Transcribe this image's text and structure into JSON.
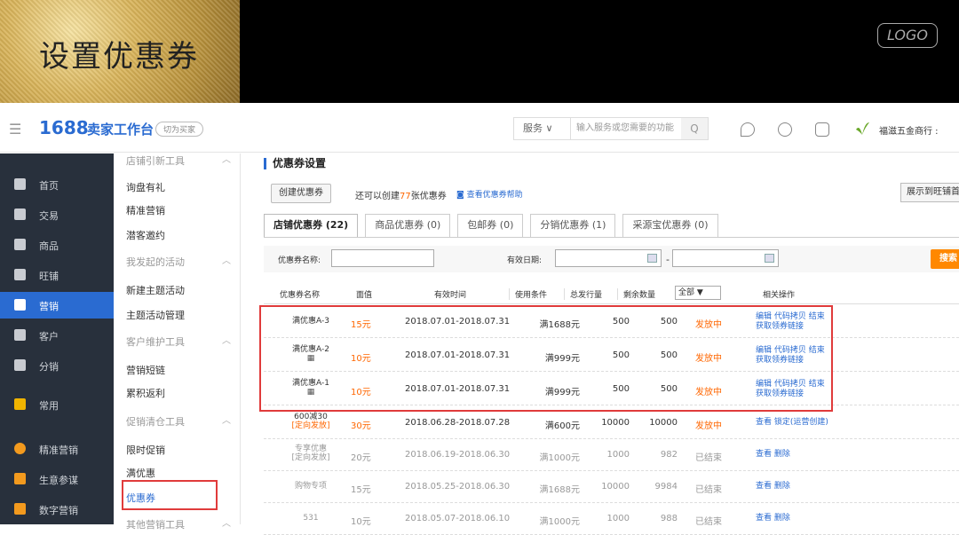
{
  "banner": {
    "title": "设置优惠券",
    "logo": "LOGO"
  },
  "topbar": {
    "menu_icon": "menu-icon",
    "brand": "1688",
    "sub_brand": "卖家工作台",
    "switch_label": "切为买家",
    "search_service": "服务 ∨",
    "search_placeholder": "输入服务或您需要的功能",
    "search_icon": "Q",
    "shop_name": "福滋五金商行 :"
  },
  "sidebar": {
    "items": [
      {
        "label": "首页",
        "icon": "home-icon"
      },
      {
        "label": "交易",
        "icon": "trade-icon"
      },
      {
        "label": "商品",
        "icon": "product-icon"
      },
      {
        "label": "旺铺",
        "icon": "shop-icon"
      },
      {
        "label": "营销",
        "icon": "marketing-icon"
      },
      {
        "label": "客户",
        "icon": "customer-icon"
      },
      {
        "label": "分销",
        "icon": "distribution-icon"
      },
      {
        "label": "常用",
        "icon": "star-icon"
      },
      {
        "label": "精准营销",
        "icon": "target-icon"
      },
      {
        "label": "生意参谋",
        "icon": "analytics-icon"
      },
      {
        "label": "数字营销",
        "icon": "digital-icon"
      }
    ]
  },
  "submenu": {
    "items": [
      {
        "label": "店铺引新工具",
        "group": true
      },
      {
        "label": "询盘有礼",
        "group": false
      },
      {
        "label": "精准营销",
        "group": false
      },
      {
        "label": "潜客邀约",
        "group": false
      },
      {
        "label": "我发起的活动",
        "group": true
      },
      {
        "label": "新建主题活动",
        "group": false
      },
      {
        "label": "主题活动管理",
        "group": false
      },
      {
        "label": "客户维护工具",
        "group": true
      },
      {
        "label": "营销短链",
        "group": false
      },
      {
        "label": "累积返利",
        "group": false
      },
      {
        "label": "促销清仓工具",
        "group": true
      },
      {
        "label": "限时促销",
        "group": false
      },
      {
        "label": "满优惠",
        "group": false
      },
      {
        "label": "优惠券",
        "group": false
      },
      {
        "label": "其他营销工具",
        "group": true
      }
    ]
  },
  "content": {
    "title": "优惠券设置",
    "create_button": "创建优惠券",
    "remain_prefix": "还可以创建",
    "remain_count": "77",
    "remain_suffix": "张优惠券",
    "help_link": "查看优惠券帮助",
    "show_wangwang": "展示到旺铺首页",
    "tabs": [
      {
        "label": "店铺优惠券 (22)",
        "active": true
      },
      {
        "label": "商品优惠券 (0)",
        "active": false
      },
      {
        "label": "包邮券 (0)",
        "active": false
      },
      {
        "label": "分销优惠券 (1)",
        "active": false
      },
      {
        "label": "采源宝优惠券 (0)",
        "active": false
      }
    ],
    "filter": {
      "name_label": "优惠券名称:",
      "date_label": "有效日期:",
      "dash": "-",
      "search_button": "搜索"
    },
    "table": {
      "headers": [
        "优惠券名称",
        "面值",
        "有效时间",
        "使用条件",
        "总发行量",
        "剩余数量",
        "相关操作"
      ],
      "status_filter": "全部  ▼",
      "rows": [
        {
          "name": "满优惠A-3",
          "qr": "",
          "value": "15元",
          "date": "2018.07.01-2018.07.31",
          "cond": "满1688元",
          "total": "500",
          "left": "500",
          "status": "发放中",
          "ops1": "编辑 代码拷贝 结束",
          "ops2": "获取领券链接"
        },
        {
          "name": "满优惠A-2",
          "qr": "▦",
          "value": "10元",
          "date": "2018.07.01-2018.07.31",
          "cond": "满999元",
          "total": "500",
          "left": "500",
          "status": "发放中",
          "ops1": "编辑 代码拷贝 结束",
          "ops2": "获取领券链接"
        },
        {
          "name": "满优惠A-1",
          "qr": "▦",
          "value": "10元",
          "date": "2018.07.01-2018.07.31",
          "cond": "满999元",
          "total": "500",
          "left": "500",
          "status": "发放中",
          "ops1": "编辑 代码拷贝 结束",
          "ops2": "获取领券链接"
        },
        {
          "name": "600减30",
          "qr": "[定向发放]",
          "value": "30元",
          "date": "2018.06.28-2018.07.28",
          "cond": "满600元",
          "total": "10000",
          "left": "10000",
          "status": "发放中",
          "ops1": "查看 锁定(运营创建)",
          "ops2": ""
        },
        {
          "name": "专享优惠",
          "qr": "[定向发放]",
          "value": "20元",
          "date": "2018.06.19-2018.06.30",
          "cond": "满1000元",
          "total": "1000",
          "left": "982",
          "status": "已结束",
          "ops1": "查看 删除",
          "ops2": ""
        },
        {
          "name": "购物专项",
          "qr": "",
          "value": "15元",
          "date": "2018.05.25-2018.06.30",
          "cond": "满1688元",
          "total": "10000",
          "left": "9984",
          "status": "已结束",
          "ops1": "查看 删除",
          "ops2": ""
        },
        {
          "name": "531",
          "qr": "",
          "value": "10元",
          "date": "2018.05.07-2018.06.10",
          "cond": "满1000元",
          "total": "1000",
          "left": "988",
          "status": "已结束",
          "ops1": "查看 删除",
          "ops2": ""
        }
      ]
    }
  },
  "colors": {
    "accent": "#2a6bd1",
    "orange": "#ff6600",
    "highlight": "#e03b3b",
    "sidebar": "#28303c"
  }
}
